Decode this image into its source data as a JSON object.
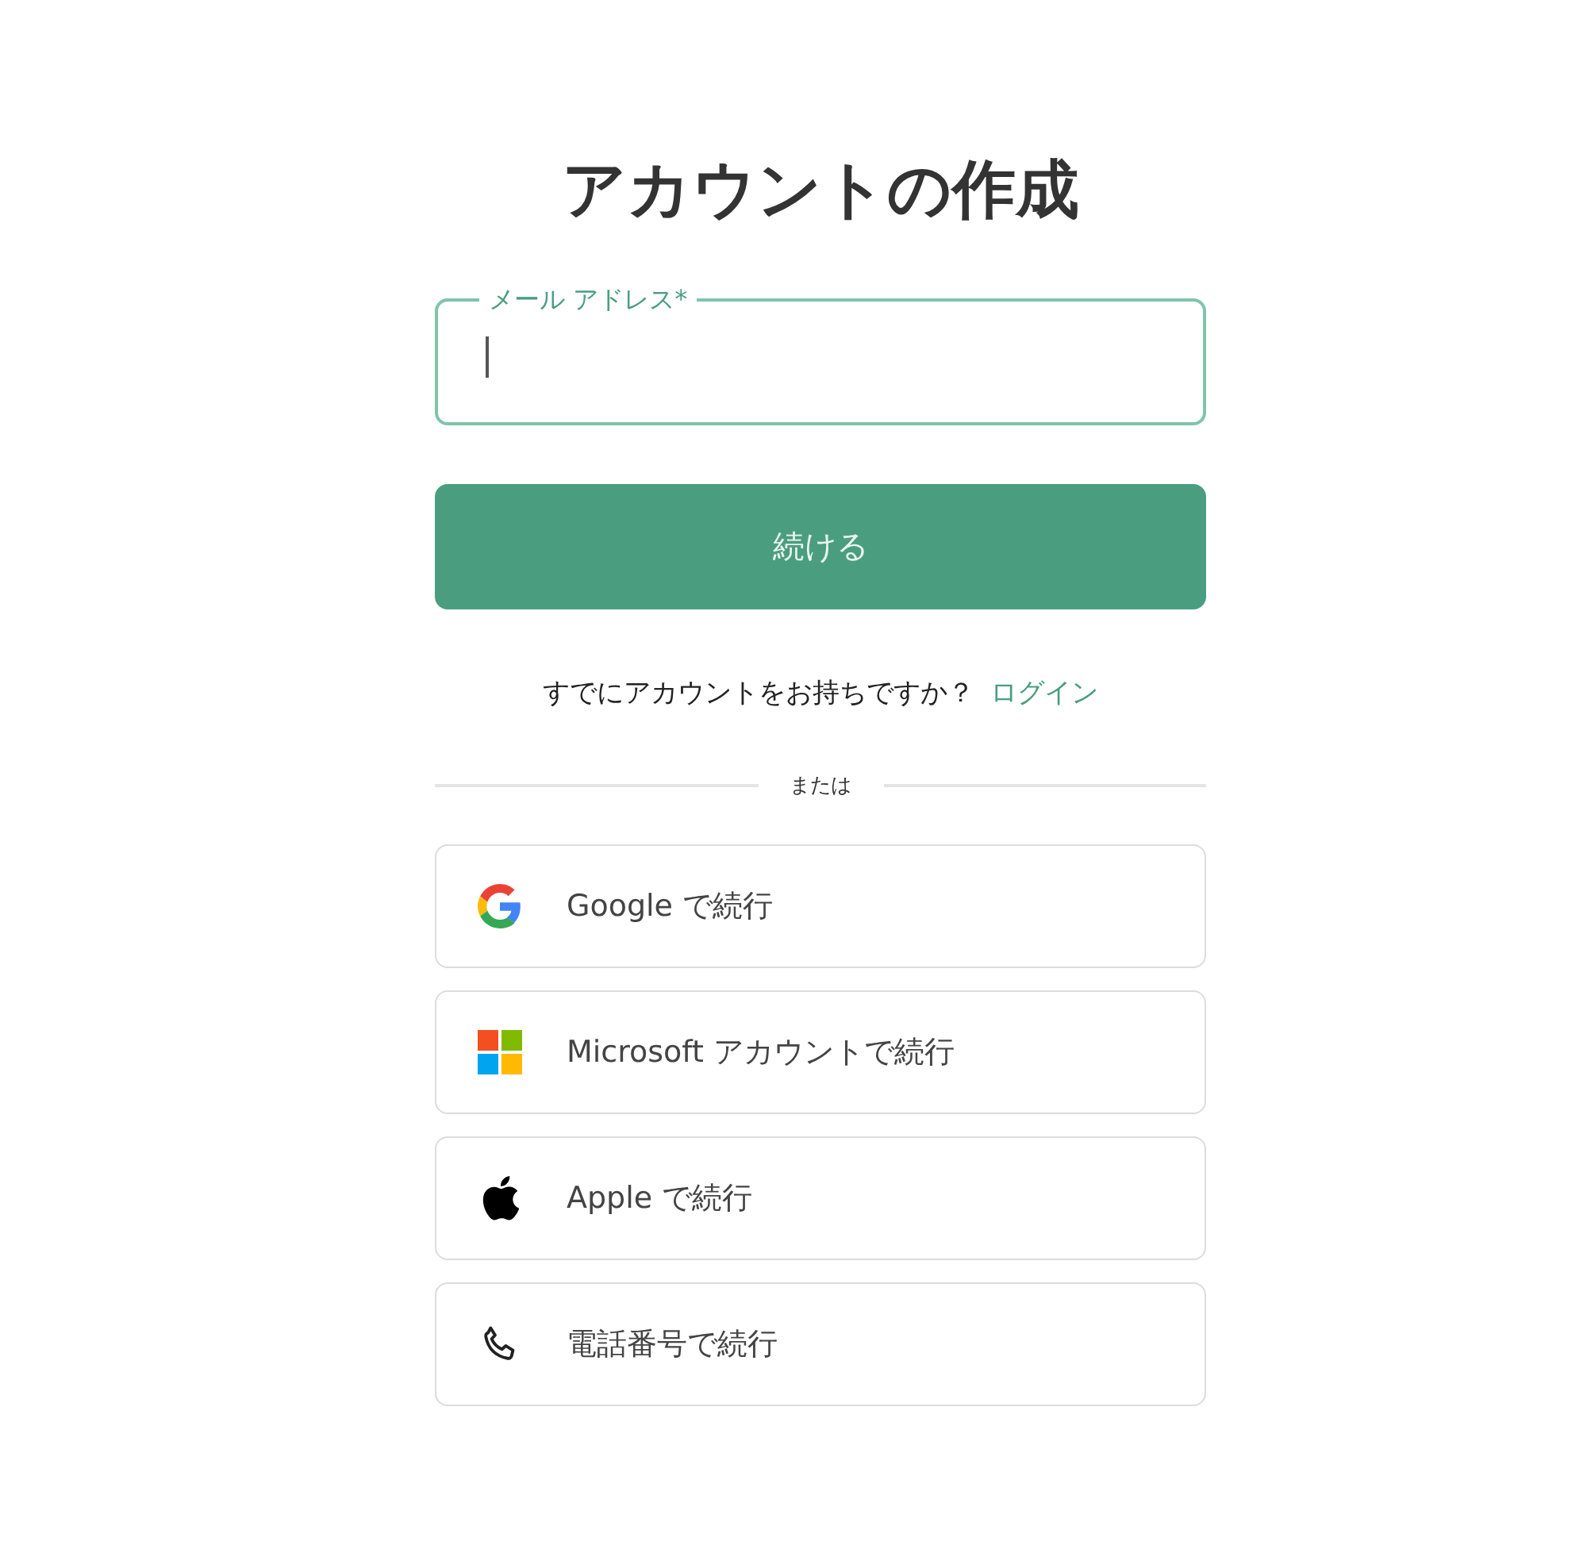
{
  "title": "アカウントの作成",
  "email_field": {
    "label": "メール アドレス*",
    "focused": true
  },
  "continue_button": "続ける",
  "login_prompt": {
    "text": "すでにアカウントをお持ちですか？",
    "link": "ログイン"
  },
  "divider_label": "または",
  "providers": [
    {
      "kind": "google",
      "label": "Google で続行"
    },
    {
      "kind": "microsoft",
      "label": "Microsoft アカウントで続行"
    },
    {
      "kind": "apple",
      "label": "Apple で続行"
    },
    {
      "kind": "phone",
      "label": "電話番号で続行"
    }
  ]
}
